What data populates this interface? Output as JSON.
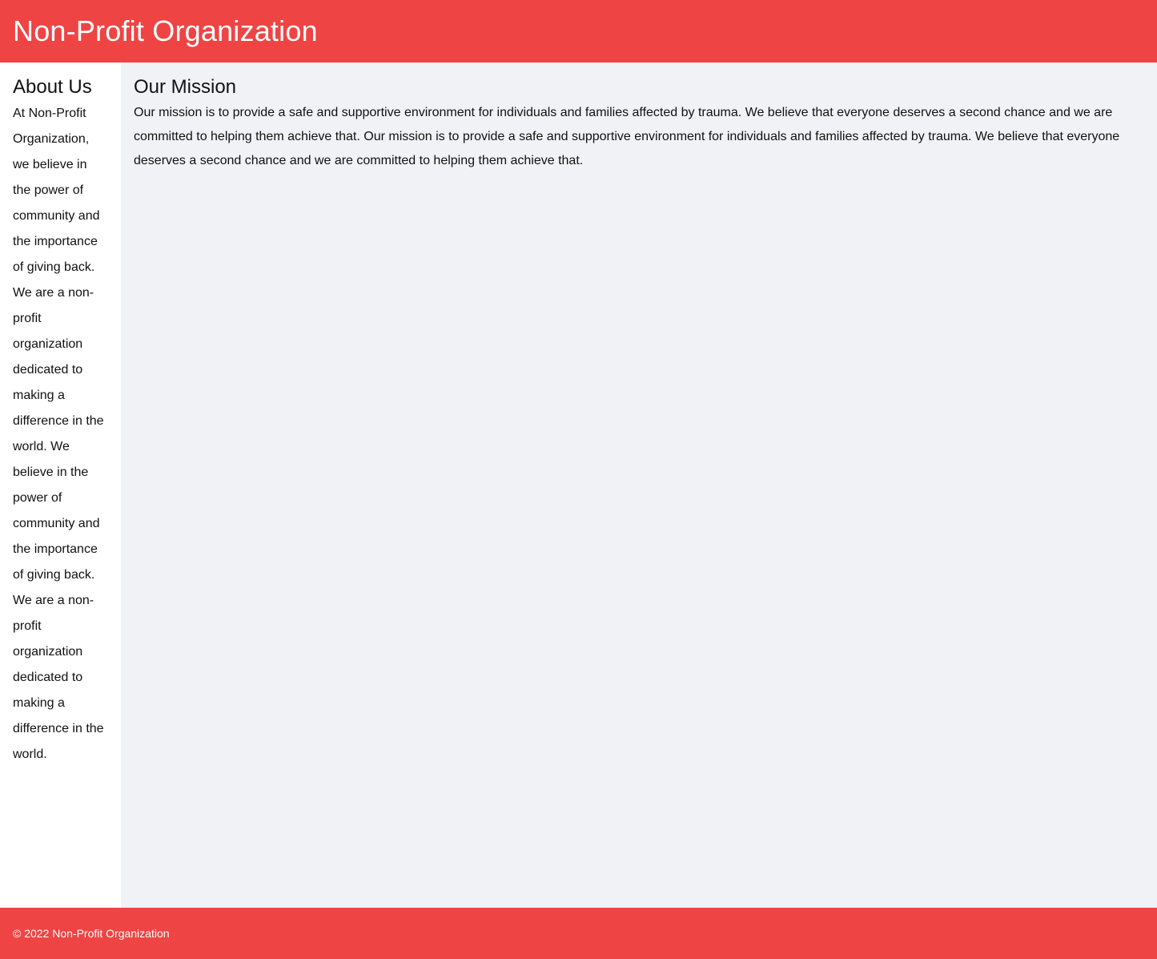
{
  "colors": {
    "brand_red": "#ef4444",
    "page_background": "#f1f2f6",
    "sidebar_background": "#ffffff",
    "text": "#111111",
    "header_text": "#ffffff"
  },
  "header": {
    "title": "Non-Profit Organization"
  },
  "sidebar": {
    "heading": "About Us",
    "body": "At Non-Profit Organization, we believe in the power of community and the importance of giving back. We are a non-profit organization dedicated to making a difference in the world. We believe in the power of community and the importance of giving back. We are a non-profit organization dedicated to making a difference in the world."
  },
  "main": {
    "heading": "Our Mission",
    "body": "Our mission is to provide a safe and supportive environment for individuals and families affected by trauma. We believe that everyone deserves a second chance and we are committed to helping them achieve that. Our mission is to provide a safe and supportive environment for individuals and families affected by trauma. We believe that everyone deserves a second chance and we are committed to helping them achieve that."
  },
  "footer": {
    "copyright": "© 2022 Non-Profit Organization"
  }
}
